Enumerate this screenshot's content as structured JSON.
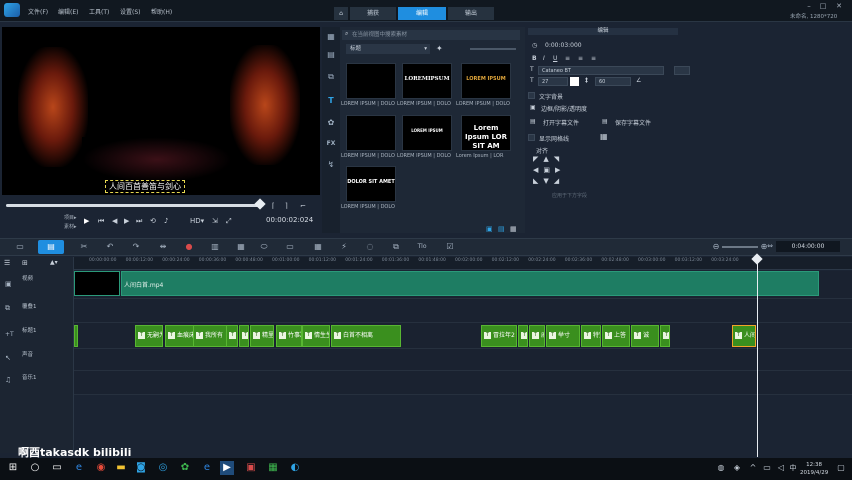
{
  "menu": [
    "文件(F)",
    "编辑(E)",
    "工具(T)",
    "设置(S)",
    "帮助(H)"
  ],
  "workspace_tabs": [
    {
      "label": "",
      "icon": "home-icon",
      "active": false
    },
    {
      "label": "捕获",
      "active": false
    },
    {
      "label": "编辑",
      "active": true
    },
    {
      "label": "输出",
      "active": false
    }
  ],
  "title_info": "未命名, 1280*720",
  "preview": {
    "subtitle_text": "人间百首善笛与剑心",
    "progress": 0.98,
    "mode_labels": [
      "项目▸",
      "素材▸"
    ],
    "timecode": "00:00:02:024"
  },
  "library": {
    "search_placeholder": "在当前视图中搜索素材",
    "category": "标题",
    "thumbs": [
      {
        "text": "",
        "caption": "LOREM IPSUM | DOLOR"
      },
      {
        "text": "LOREMIPSUM",
        "caption": "LOREM IPSUM | DOLOR"
      },
      {
        "text": "LOREM IPSUM",
        "caption": "LOREM IPSUM | DOLOR"
      },
      {
        "text": "",
        "caption": "LOREM IPSUM | DOLOR"
      },
      {
        "text": "LOREM IPSUM",
        "caption": "LOREM IPSUM | DOLOR"
      },
      {
        "text": "Lorem Ipsum LOR SIT AM",
        "caption": "Lorem Ipsum | LOR"
      },
      {
        "text": "DOLOR SIT AMET",
        "caption": "LOREM IPSUM | DOLOR"
      }
    ]
  },
  "options": {
    "title": "编辑",
    "duration": "0:00:03:000",
    "font_name": "Cataneo BT",
    "font_size": "27",
    "line_spacing": "60",
    "text_background": "文字背景",
    "border_shadow": "边框/阴影/透明度",
    "open_subtitle": "打开字幕文件",
    "save_subtitle": "保存字幕文件",
    "show_grid": "显示网格线",
    "align": "对齐",
    "align_hint": "应用于下方字段"
  },
  "timeline": {
    "timecode": "0:04:00:00",
    "ruler_ticks": [
      "00:00:00:00",
      "00:00:12:00",
      "00:00:24:00",
      "00:00:36:00",
      "00:00:48:00",
      "00:01:00:00",
      "00:01:12:00",
      "00:01:24:00",
      "00:01:36:00",
      "00:01:48:00",
      "00:02:00:00",
      "00:02:12:00",
      "00:02:24:00",
      "00:02:36:00",
      "00:02:48:00",
      "00:03:00:00",
      "00:03:12:00",
      "00:03:24:00"
    ],
    "tracks": [
      "视频",
      "覆叠1",
      "标题1",
      "声音",
      "音乐1"
    ],
    "video_clip": "人间白首.mp4",
    "title_clips": [
      "",
      "无嗣为",
      "血痕床",
      "我所有",
      "",
      "",
      "精里无",
      "竹事凉",
      "情生生",
      "白首不相离",
      "冒拉年2",
      "才知",
      "戚许天长",
      "举寸",
      "特究执",
      "上答",
      "诚",
      "柴生羽两体"
    ],
    "selected_clip": "人间"
  },
  "watermark": "啊酉takasdk bilibili",
  "taskbar": {
    "time": "12:38",
    "date": "2019/4/29",
    "ime": "中"
  }
}
